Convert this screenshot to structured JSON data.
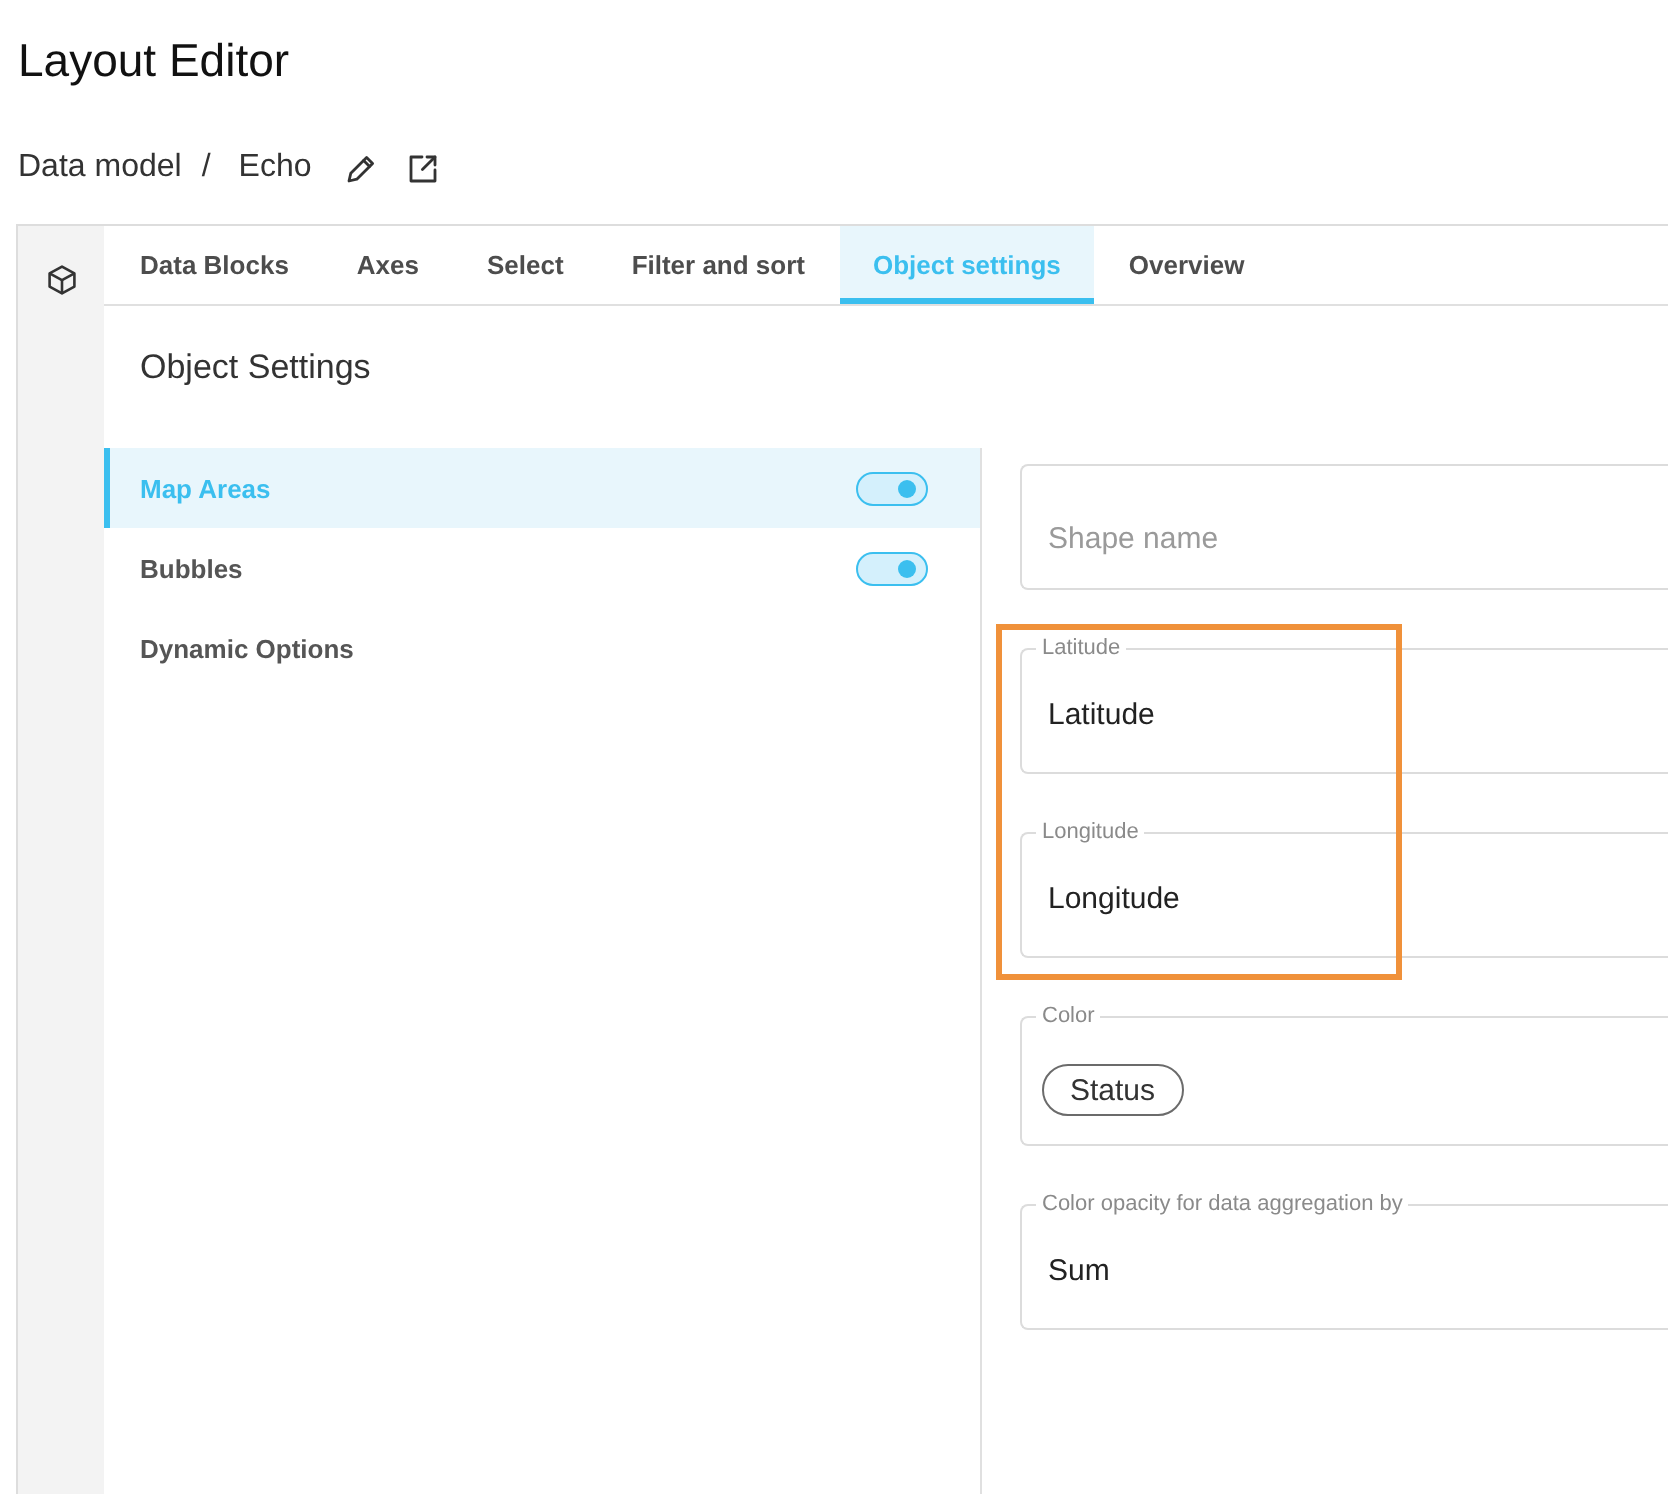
{
  "header": {
    "title": "Layout Editor",
    "breadcrumb": {
      "items": [
        "Data model",
        "Echo"
      ],
      "separator": "/"
    }
  },
  "tabs": [
    {
      "label": "Data Blocks",
      "selected": false
    },
    {
      "label": "Axes",
      "selected": false
    },
    {
      "label": "Select",
      "selected": false
    },
    {
      "label": "Filter and sort",
      "selected": false
    },
    {
      "label": "Object settings",
      "selected": true
    },
    {
      "label": "Overview",
      "selected": false
    }
  ],
  "section_title": "Object Settings",
  "layers": [
    {
      "kind": "toggle",
      "label": "Map Areas",
      "selected": true,
      "on": true
    },
    {
      "kind": "toggle",
      "label": "Bubbles",
      "selected": false,
      "on": true
    },
    {
      "kind": "plain",
      "label": "Dynamic Options",
      "selected": false
    }
  ],
  "fields": [
    {
      "kind": "text",
      "placeholder": "Shape name",
      "highlighted": false
    },
    {
      "kind": "text",
      "label": "Latitude",
      "value": "Latitude",
      "highlighted": true
    },
    {
      "kind": "text",
      "label": "Longitude",
      "value": "Longitude",
      "highlighted": true
    },
    {
      "kind": "chips",
      "label": "Color",
      "chips": [
        "Status"
      ],
      "highlighted": false
    },
    {
      "kind": "text",
      "label": "Color opacity for data aggregation by",
      "value": "Sum",
      "highlighted": false
    }
  ]
}
